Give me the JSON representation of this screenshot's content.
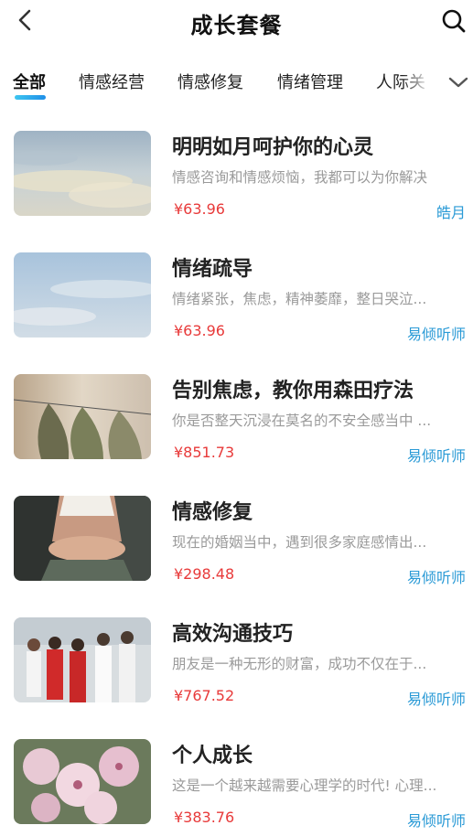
{
  "header": {
    "title": "成长套餐"
  },
  "tabs": [
    {
      "label": "全部",
      "active": true
    },
    {
      "label": "情感经营",
      "active": false
    },
    {
      "label": "情感修复",
      "active": false
    },
    {
      "label": "情绪管理",
      "active": false
    },
    {
      "label": "人际关",
      "active": false
    }
  ],
  "colors": {
    "accent": "#2a9ad6",
    "price": "#e83a3a",
    "indicator_start": "#3ec6f0",
    "indicator_end": "#1f8fe8"
  },
  "icons": {
    "back": "back-arrow-icon",
    "search": "search-icon",
    "expand": "chevron-down-icon"
  },
  "packages": [
    {
      "title": "明明如月呵护你的心灵",
      "desc": "情感咨询和情感烦恼，我都可以为你解决",
      "price": "¥63.96",
      "author": "皓月"
    },
    {
      "title": "情绪疏导",
      "desc": "情绪紧张，焦虑，精神萎靡，整日哭泣...",
      "price": "¥63.96",
      "author": "易倾听师"
    },
    {
      "title": "告别焦虑，教你用森田疗法",
      "desc": "你是否整天沉浸在莫名的不安全感当中 ...",
      "price": "¥851.73",
      "author": "易倾听师"
    },
    {
      "title": "情感修复",
      "desc": "现在的婚姻当中，遇到很多家庭感情出...",
      "price": "¥298.48",
      "author": "易倾听师"
    },
    {
      "title": "高效沟通技巧",
      "desc": "朋友是一种无形的财富，成功不仅在于...",
      "price": "¥767.52",
      "author": "易倾听师"
    },
    {
      "title": "个人成长",
      "desc": "这是一个越来越需要心理学的时代! 心理...",
      "price": "¥383.76",
      "author": "易倾听师"
    }
  ]
}
